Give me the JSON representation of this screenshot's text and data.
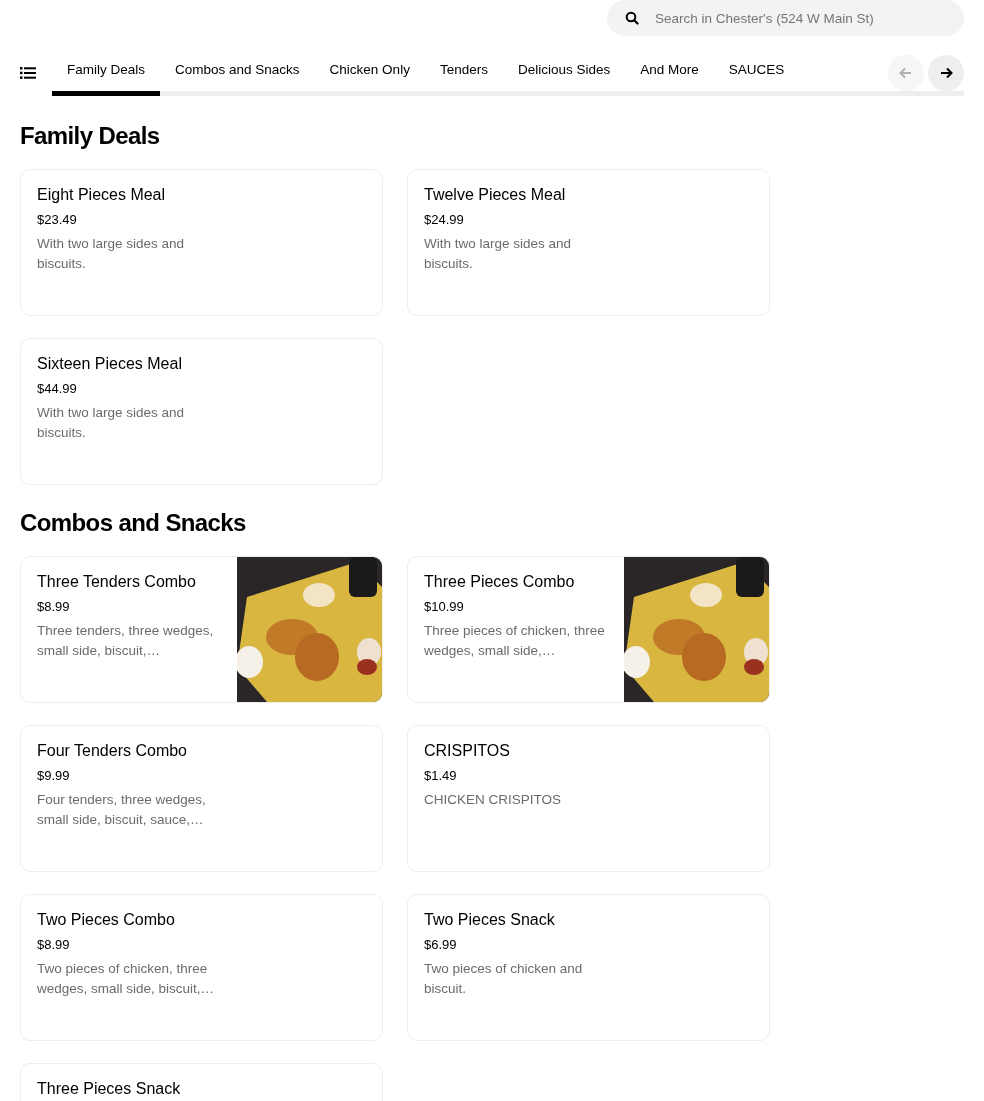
{
  "search": {
    "placeholder": "Search in Chester's (524 W Main St)"
  },
  "tabs": [
    {
      "label": "Family Deals",
      "selected": true
    },
    {
      "label": "Combos and Snacks",
      "selected": false
    },
    {
      "label": "Chicken Only",
      "selected": false
    },
    {
      "label": "Tenders",
      "selected": false
    },
    {
      "label": "Delicious Sides",
      "selected": false
    },
    {
      "label": "And More",
      "selected": false
    },
    {
      "label": "SAUCES",
      "selected": false
    }
  ],
  "tab_scroll": {
    "back_disabled": true,
    "forward_disabled": false
  },
  "sections": [
    {
      "title": "Family Deals",
      "items": [
        {
          "name": "Eight Pieces Meal",
          "price": "$23.49",
          "description": "With two large sides and biscuits."
        },
        {
          "name": "Twelve Pieces Meal",
          "price": "$24.99",
          "description": "With two large sides and biscuits."
        },
        {
          "name": "Sixteen Pieces Meal",
          "price": "$44.99",
          "description": "With two large sides and biscuits."
        }
      ]
    },
    {
      "title": "Combos and Snacks",
      "items": [
        {
          "name": "Three Tenders Combo",
          "price": "$8.99",
          "description": "Three tenders, three wedges, small side, biscuit,…"
        },
        {
          "name": "Three Pieces Combo",
          "price": "$10.99",
          "description": "Three pieces of chicken, three wedges, small side,…"
        },
        {
          "name": "Four Tenders Combo",
          "price": "$9.99",
          "description": "Four tenders, three wedges, small side, biscuit, sauce,…"
        },
        {
          "name": "CRISPITOS",
          "price": "$1.49",
          "description": "CHICKEN CRISPITOS"
        },
        {
          "name": "Two Pieces Combo",
          "price": "$8.99",
          "description": "Two pieces of chicken, three wedges, small side, biscuit,…"
        },
        {
          "name": "Two Pieces Snack",
          "price": "$6.99",
          "description": "Two pieces of chicken and biscuit."
        },
        {
          "name": "Three Pieces Snack"
        }
      ]
    }
  ]
}
